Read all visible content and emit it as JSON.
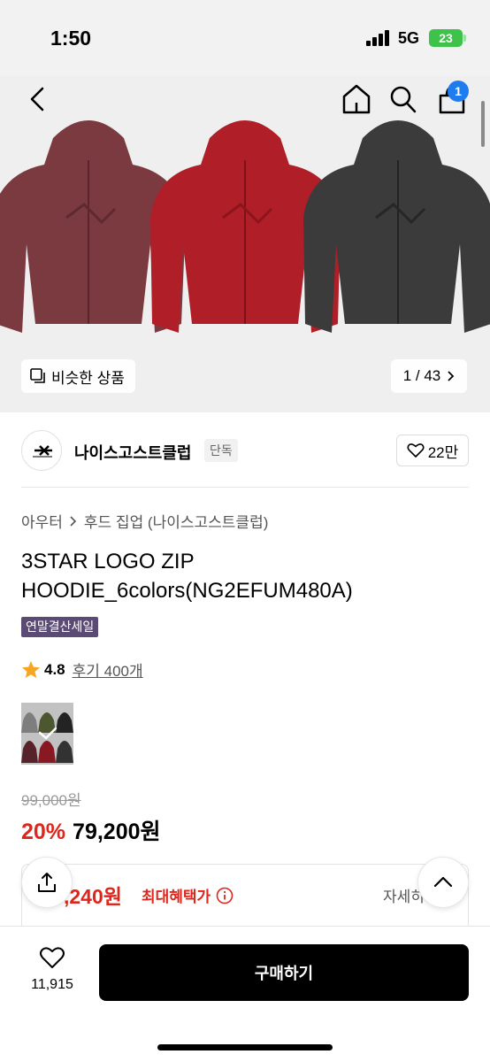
{
  "status_bar": {
    "time": "1:50",
    "network": "5G",
    "battery": "23"
  },
  "header": {
    "back_icon": "chevron-left-icon",
    "home_icon": "home-icon",
    "search_icon": "search-icon",
    "bag_icon": "shopping-bag-icon",
    "bag_count": "1"
  },
  "gallery": {
    "similar_label": "비슷한 상품",
    "page_indicator": "1 / 43",
    "hoodie_colors": [
      "#7a3a40",
      "#b01e28",
      "#3b3b3b"
    ]
  },
  "brand": {
    "name": "나이스고스트클럽",
    "tag": "단독",
    "likes": "22만"
  },
  "breadcrumb": {
    "category": "아우터",
    "subcategory": "후드 집업 (나이스고스트클럽)"
  },
  "product": {
    "title": "3STAR LOGO ZIP HOODIE_6colors(NG2EFUM480A)",
    "sale_badge": "연말결산세일",
    "rating": "4.8",
    "reviews": "후기 400개",
    "original_price": "99,000원",
    "discount": "20%",
    "price": "79,200원"
  },
  "benefit": {
    "amount": ",240원",
    "label": "최대혜택가",
    "detail": "자세히"
  },
  "bottom": {
    "like_count": "11,915",
    "buy_label": "구매하기"
  },
  "colors": {
    "sale_red": "#e1251b",
    "badge_purple": "#5a4b75",
    "badge_blue": "#1f7cf0",
    "star": "#f5a623"
  }
}
